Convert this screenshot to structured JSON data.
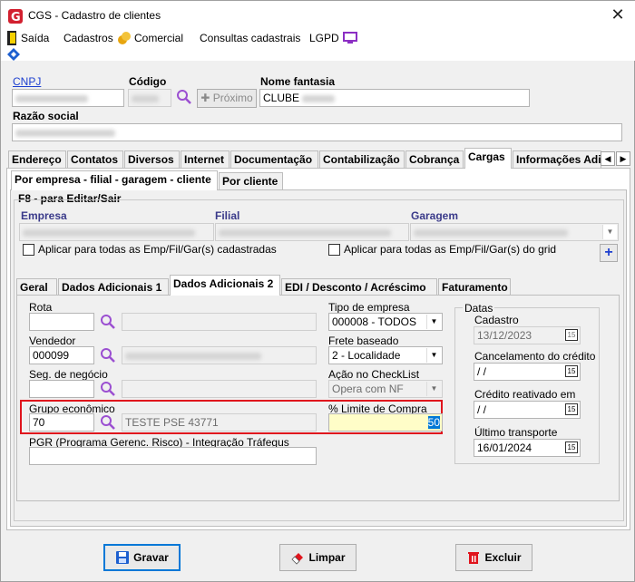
{
  "window": {
    "title": "CGS - Cadastro de clientes",
    "close": "✕"
  },
  "menu": {
    "saida": "Saída",
    "cadastros": "Cadastros",
    "comercial": "Comercial",
    "consultas": "Consultas cadastrais",
    "lgpd": "LGPD"
  },
  "header": {
    "cnpj_label": "CNPJ",
    "codigo_label": "Código",
    "nome_fantasia_label": "Nome fantasia",
    "nome_fantasia_value": "CLUBE",
    "proximo_label": "Próximo",
    "razao_social_label": "Razão social"
  },
  "main_tabs": [
    "Endereço",
    "Contatos",
    "Diversos",
    "Internet",
    "Documentação",
    "Contabilização",
    "Cobrança",
    "Cargas",
    "Informações Adi"
  ],
  "sub_tabs": [
    "Por empresa - filial - garagem - cliente",
    "Por cliente"
  ],
  "f8_label": "F8 - para Editar/Sair",
  "empresa_label": "Empresa",
  "filial_label": "Filial",
  "garagem_label": "Garagem",
  "aplicar_all": "Aplicar para todas as Emp/Fil/Gar(s) cadastradas",
  "aplicar_grid": "Aplicar para todas as Emp/Fil/Gar(s) do grid",
  "plus": "+",
  "inner_tabs": [
    "Geral",
    "Dados Adicionais 1",
    "Dados Adicionais 2",
    "EDI / Desconto / Acréscimo",
    "Faturamento"
  ],
  "form": {
    "rota_label": "Rota",
    "vendedor_label": "Vendedor",
    "vendedor_value": "000099",
    "seg_label": "Seg. de negócio",
    "grupo_label": "Grupo econômico",
    "grupo_value": "70",
    "grupo_desc": "TESTE PSE 43771",
    "pgr_label": "PGR (Programa Gerenc. Risco) - Integração Tráfegus",
    "tipo_empresa_label": "Tipo de empresa",
    "tipo_empresa_value": "000008 - TODOS",
    "frete_label": "Frete baseado",
    "frete_value": "2 - Localidade",
    "acao_label": "Ação no CheckList",
    "acao_value": "Opera com NF",
    "limite_label": "% Limite de Compra",
    "limite_value": "50"
  },
  "datas": {
    "title": "Datas",
    "cadastro_label": "Cadastro",
    "cadastro_value": "13/12/2023",
    "cancel_label": "Cancelamento do crédito",
    "cancel_value": " / /",
    "reativado_label": "Crédito reativado em",
    "reativado_value": " / /",
    "ultimo_label": "Último transporte",
    "ultimo_value": "16/01/2024",
    "cal_icon": "15"
  },
  "buttons": {
    "gravar": "Gravar",
    "limpar": "Limpar",
    "excluir": "Excluir"
  },
  "colors": {
    "accent": "#0078d7",
    "highlight_yellow": "#fffdc8",
    "red": "#e0151d"
  }
}
